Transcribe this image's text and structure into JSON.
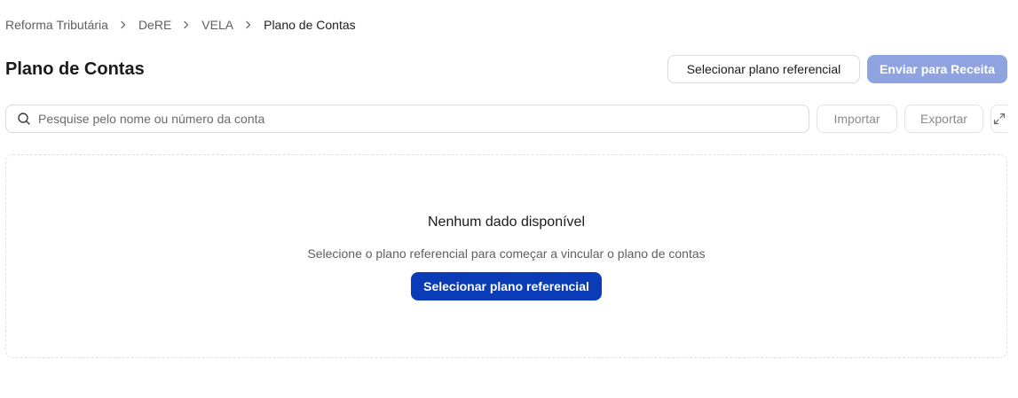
{
  "breadcrumb": {
    "items": [
      {
        "label": "Reforma Tributária"
      },
      {
        "label": "DeRE"
      },
      {
        "label": "VELA"
      },
      {
        "label": "Plano de Contas"
      }
    ],
    "separator_icon": "chevron-right-icon"
  },
  "header": {
    "title": "Plano de Contas",
    "select_plan_label": "Selecionar plano referencial",
    "send_label": "Enviar para Receita"
  },
  "toolbar": {
    "search_placeholder": "Pesquise pelo nome ou número da conta",
    "search_value": "",
    "search_icon": "search-icon",
    "import_label": "Importar",
    "export_label": "Exportar",
    "expand_icon": "expand-icon"
  },
  "empty_state": {
    "title": "Nenhum dado disponível",
    "description": "Selecione o plano referencial para começar a vincular o plano de contas",
    "action_label": "Selecionar plano referencial"
  },
  "colors": {
    "primary": "#0a3cb8",
    "primary_disabled": "#8ea3e0",
    "border": "#d9d9d9",
    "muted_text": "#5f5f5f"
  }
}
